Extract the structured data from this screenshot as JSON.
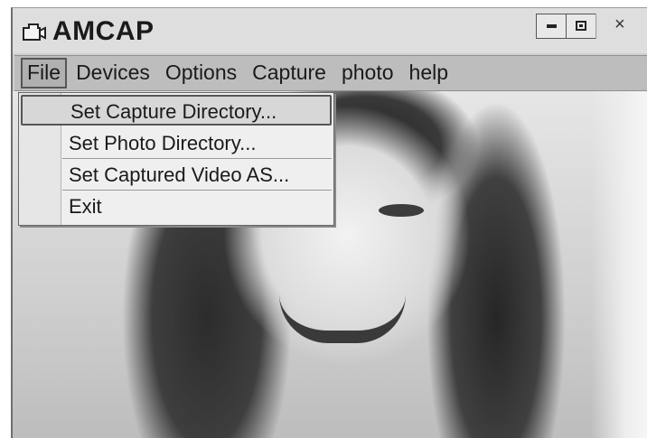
{
  "window": {
    "title": "AMCAP",
    "icons": {
      "app": "camera-icon",
      "minimize": "minimize-icon",
      "maximize": "maximize-icon",
      "close": "close-icon"
    },
    "close_glyph": "×"
  },
  "menubar": {
    "items": [
      {
        "label": "File",
        "active": true
      },
      {
        "label": "Devices"
      },
      {
        "label": "Options"
      },
      {
        "label": "Capture"
      },
      {
        "label": "photo"
      },
      {
        "label": "help"
      }
    ]
  },
  "file_menu": {
    "items": [
      {
        "label": "Set Capture Directory...",
        "highlighted": true
      },
      {
        "label": "Set Photo Directory..."
      },
      {
        "label": "Set Captured Video AS..."
      },
      {
        "label": "Exit"
      }
    ]
  },
  "colors": {
    "menubar_bg": "#bdbdbd",
    "menu_bg": "#efefef",
    "highlight_bg": "#d7d7d7"
  }
}
